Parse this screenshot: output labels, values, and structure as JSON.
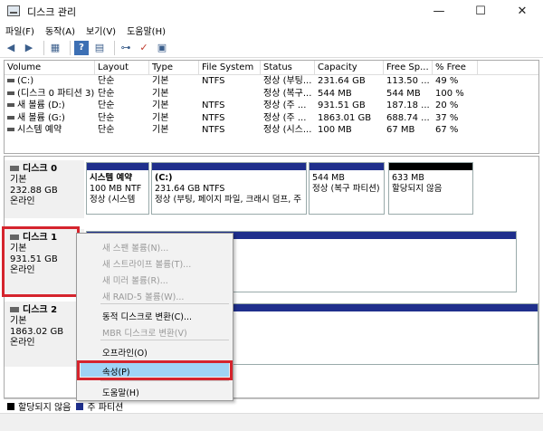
{
  "window": {
    "title": "디스크 관리",
    "controls": {
      "minimize": "—",
      "maximize": "☐",
      "close": "✕"
    }
  },
  "menu": [
    "파일(F)",
    "동작(A)",
    "보기(V)",
    "도움말(H)"
  ],
  "toolbar_icons": [
    "back-arrow-icon",
    "forward-arrow-icon",
    "console-icon",
    "help-icon",
    "disk-view-icon",
    "connect-icon",
    "check-icon",
    "properties-icon"
  ],
  "volume_table": {
    "headers": [
      "Volume",
      "Layout",
      "Type",
      "File System",
      "Status",
      "Capacity",
      "Free Sp...",
      "% Free"
    ],
    "rows": [
      [
        "(C:)",
        "단순",
        "기본",
        "NTFS",
        "정상 (부팅...",
        "231.64 GB",
        "113.50 ...",
        "49 %"
      ],
      [
        "(디스크 0 파티션 3)",
        "단순",
        "기본",
        "",
        "정상 (복구...",
        "544 MB",
        "544 MB",
        "100 %"
      ],
      [
        "새 볼륨 (D:)",
        "단순",
        "기본",
        "NTFS",
        "정상 (주 ...",
        "931.51 GB",
        "187.18 ...",
        "20 %"
      ],
      [
        "새 볼륨 (G:)",
        "단순",
        "기본",
        "NTFS",
        "정상 (주 ...",
        "1863.01 GB",
        "688.74 ...",
        "37 %"
      ],
      [
        "시스템 예약",
        "단순",
        "기본",
        "NTFS",
        "정상 (시스...",
        "100 MB",
        "67 MB",
        "67 %"
      ]
    ]
  },
  "disks": [
    {
      "name": "디스크 0",
      "type": "기본",
      "size": "232.88 GB",
      "state": "온라인"
    },
    {
      "name": "디스크 1",
      "type": "기본",
      "size": "931.51 GB",
      "state": "온라인"
    },
    {
      "name": "디스크 2",
      "type": "기본",
      "size": "1863.02 GB",
      "state": "온라인"
    }
  ],
  "disk0_partitions": [
    {
      "name": "시스템 예약",
      "line2": "100 MB NTF",
      "line3": "정상 (시스템"
    },
    {
      "name": "(C:)",
      "line2": "231.64 GB NTFS",
      "line3": "정상 (부팅, 페이지 파일, 크래시 덤프, 주"
    },
    {
      "name": "",
      "line2": "544 MB",
      "line3": "정상 (복구 파티션)"
    },
    {
      "name": "",
      "line2": "633 MB",
      "line3": "할당되지 않음"
    }
  ],
  "context_menu": {
    "items": [
      {
        "label": "새 스팬 볼륨(N)...",
        "enabled": false
      },
      {
        "label": "새 스트라이프 볼륨(T)...",
        "enabled": false
      },
      {
        "label": "새 미러 볼륨(R)...",
        "enabled": false
      },
      {
        "label": "새 RAID-5 볼륨(W)...",
        "enabled": false
      },
      {
        "label": "동적 디스크로 변환(C)...",
        "enabled": true
      },
      {
        "label": "MBR 디스크로 변환(V)",
        "enabled": false
      },
      {
        "label": "오프라인(O)",
        "enabled": true
      },
      {
        "label": "속성(P)",
        "enabled": true
      },
      {
        "label": "도움말(H)",
        "enabled": true
      }
    ]
  },
  "legend": [
    {
      "label": "할당되지 않음",
      "color": "#000000"
    },
    {
      "label": "주 파티션",
      "color": "#1f2f8c"
    }
  ],
  "colors": {
    "partition_bar": "#1f2f8c",
    "unallocated_bar": "#000000",
    "highlight": "#9fd3f5",
    "annotation": "#d5242d"
  }
}
